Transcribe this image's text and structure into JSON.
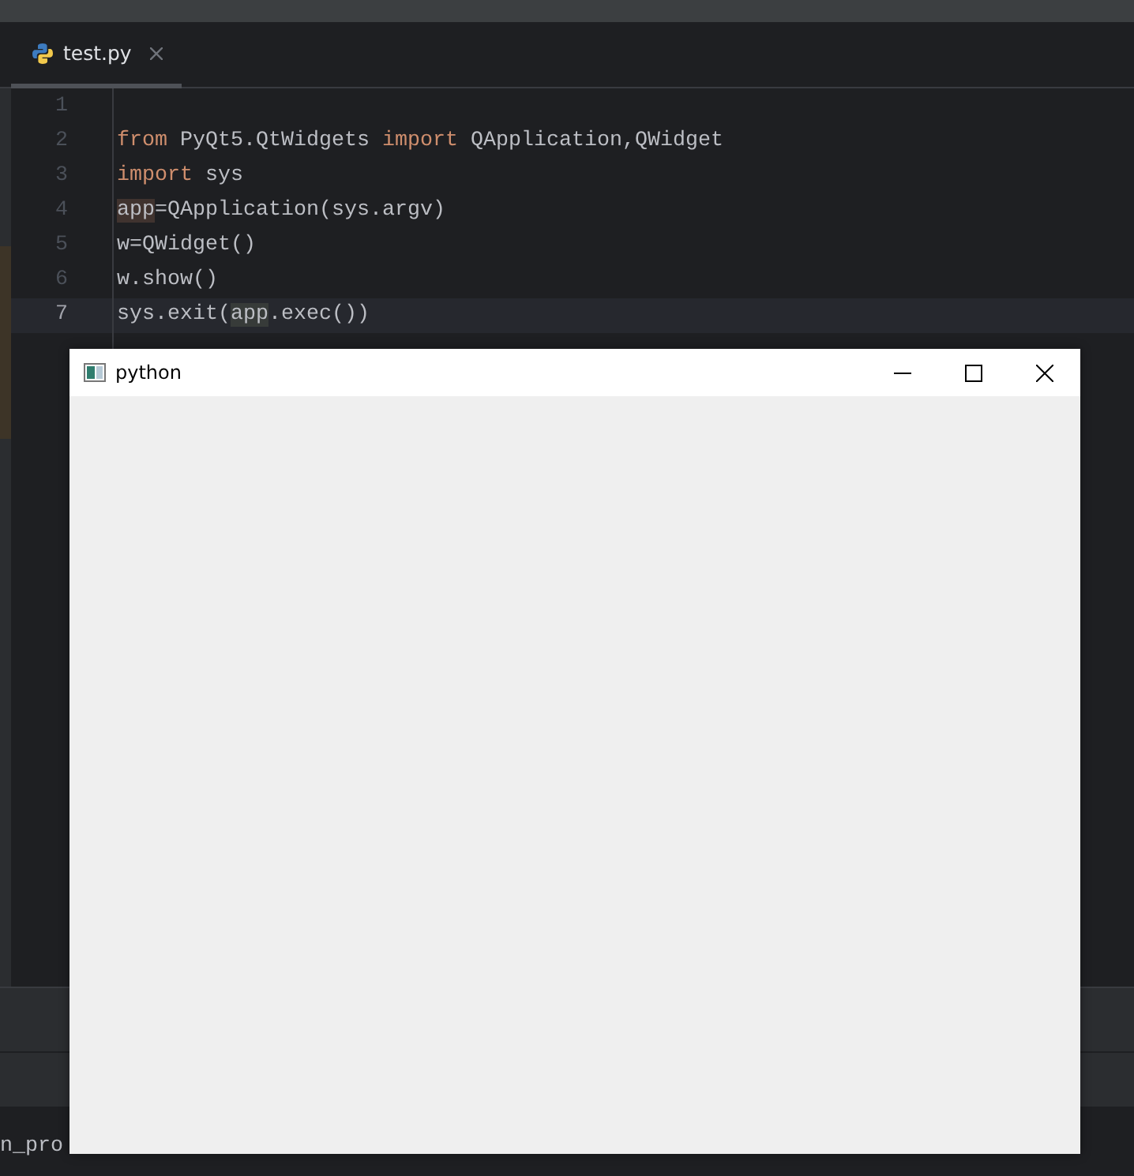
{
  "editor": {
    "tab": {
      "label": "test.py",
      "selected": true
    },
    "lines": [
      {
        "number": "1",
        "current": false
      },
      {
        "number": "2",
        "current": false,
        "tokens": [
          {
            "kind": "keyword",
            "text": "from"
          },
          {
            "kind": "text",
            "text": " PyQt5.QtWidgets "
          },
          {
            "kind": "keyword",
            "text": "import"
          },
          {
            "kind": "text",
            "text": " QApplication,QWidget"
          }
        ]
      },
      {
        "number": "3",
        "current": false,
        "tokens": [
          {
            "kind": "keyword",
            "text": "import"
          },
          {
            "kind": "text",
            "text": " sys"
          }
        ]
      },
      {
        "number": "4",
        "current": false,
        "tokens": [
          {
            "kind": "write",
            "text": "app"
          },
          {
            "kind": "text",
            "text": "=QApplication(sys.argv)"
          }
        ]
      },
      {
        "number": "5",
        "current": false,
        "tokens": [
          {
            "kind": "text",
            "text": "w=QWidget()"
          }
        ]
      },
      {
        "number": "6",
        "current": false,
        "tokens": [
          {
            "kind": "text",
            "text": "w.show()"
          }
        ]
      },
      {
        "number": "7",
        "current": true,
        "tokens": [
          {
            "kind": "text",
            "text": "sys.exit("
          },
          {
            "kind": "read",
            "text": "app"
          },
          {
            "kind": "text",
            "text": ".exec())"
          }
        ]
      }
    ]
  },
  "bottom_panel": {
    "text": "n_pro"
  },
  "app_window": {
    "title": "python"
  }
}
